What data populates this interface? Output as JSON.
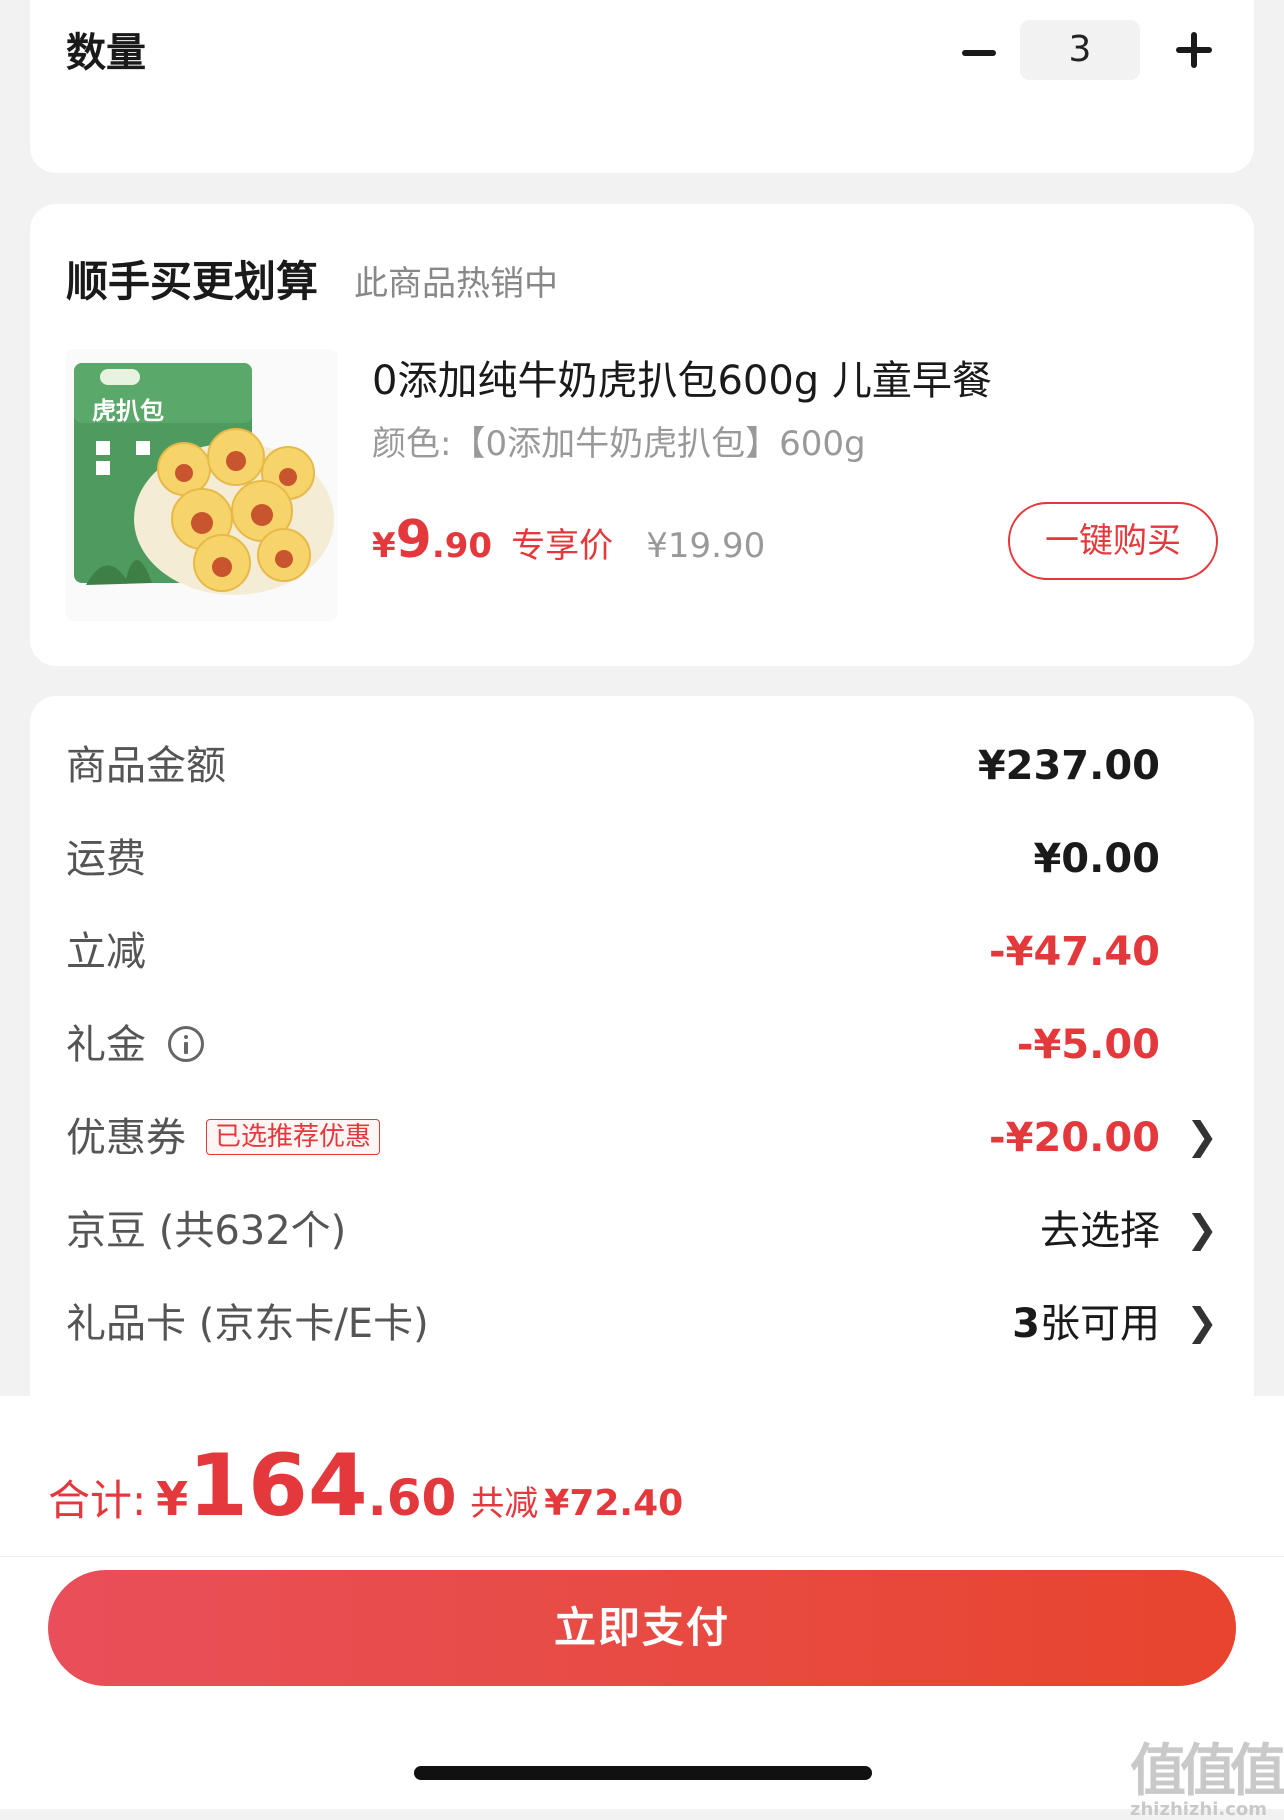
{
  "quantity": {
    "label": "数量",
    "value": "3",
    "minus_icon": "minus-icon",
    "plus_icon": "plus-icon"
  },
  "recommend": {
    "title": "顺手买更划算",
    "subtitle": "此商品热销中",
    "product": {
      "name": "0添加纯牛奶虎扒包600g 儿童早餐",
      "spec": "颜色:【0添加牛奶虎扒包】600g",
      "price_symbol": "¥",
      "price_integer": "9",
      "price_decimal": ".90",
      "price_tag": "专享价",
      "original_price": "¥19.90",
      "image_text": "虎扒包",
      "buy_label": "一键购买"
    }
  },
  "summary": {
    "rows": [
      {
        "label": "商品金额",
        "value": "¥237.00"
      },
      {
        "label": "运费",
        "value": "¥0.00"
      },
      {
        "label": "立减",
        "value": "-¥47.40"
      },
      {
        "label": "礼金",
        "value": "-¥5.00"
      },
      {
        "label": "优惠券",
        "badge": "已选推荐优惠",
        "value": "-¥20.00"
      },
      {
        "label": "京豆 (共632个)",
        "value": "去选择"
      },
      {
        "label": "礼品卡 (京东卡/E卡)",
        "value_bold": "3",
        "value_rest": "张可用"
      }
    ]
  },
  "footer": {
    "total_label": "合计:",
    "total_symbol": "¥",
    "total_integer": "164",
    "total_decimal": ".60",
    "saved_label": "共减",
    "saved_value": "¥72.40",
    "pay_label": "立即支付",
    "watermark": "值值值",
    "watermark_url": "zhizhizhi.com"
  },
  "colors": {
    "accent": "#e4393c",
    "pay_gradient_start": "#e94f5a",
    "pay_gradient_end": "#e8442e"
  }
}
